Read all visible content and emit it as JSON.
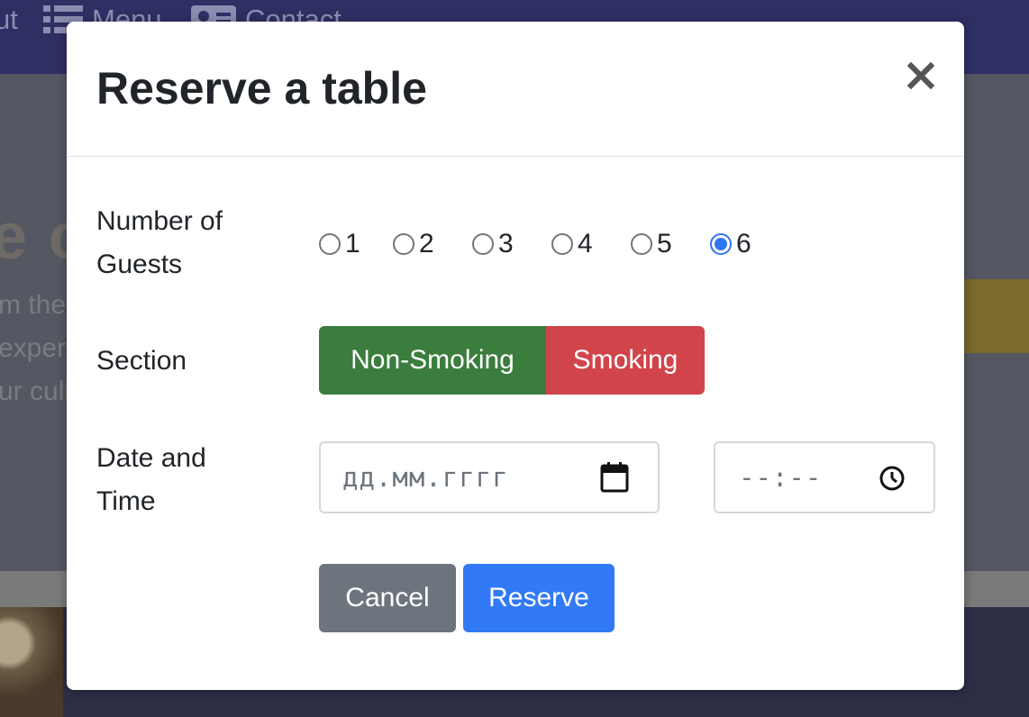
{
  "background": {
    "nav_items": [
      {
        "label": "ut",
        "icon": "none"
      },
      {
        "label": "Menu",
        "icon": "list-icon"
      },
      {
        "label": "Contact",
        "icon": "contact-card-icon"
      }
    ],
    "hero_heading": "e c",
    "hero_lines": [
      "m the",
      "exper",
      "ur culi"
    ]
  },
  "modal": {
    "title": "Reserve a table",
    "close_label": "×",
    "guests": {
      "label_line1": "Number of",
      "label_line2": "Guests",
      "options": [
        "1",
        "2",
        "3",
        "4",
        "5",
        "6"
      ],
      "selected": "6"
    },
    "section": {
      "label": "Section",
      "options": [
        "Non-Smoking",
        "Smoking"
      ]
    },
    "datetime": {
      "label_line1": "Date and",
      "label_line2": "Time",
      "date_placeholder": "дд.мм.гггг",
      "time_placeholder": "--:--"
    },
    "actions": {
      "cancel": "Cancel",
      "reserve": "Reserve"
    }
  },
  "colors": {
    "non_smoking": "#3a7d3d",
    "smoking": "#d0444a",
    "cancel": "#6c757d",
    "reserve": "#3279f5",
    "radio_selected": "#2f74f0",
    "nav_bg": "#2e2f63"
  }
}
